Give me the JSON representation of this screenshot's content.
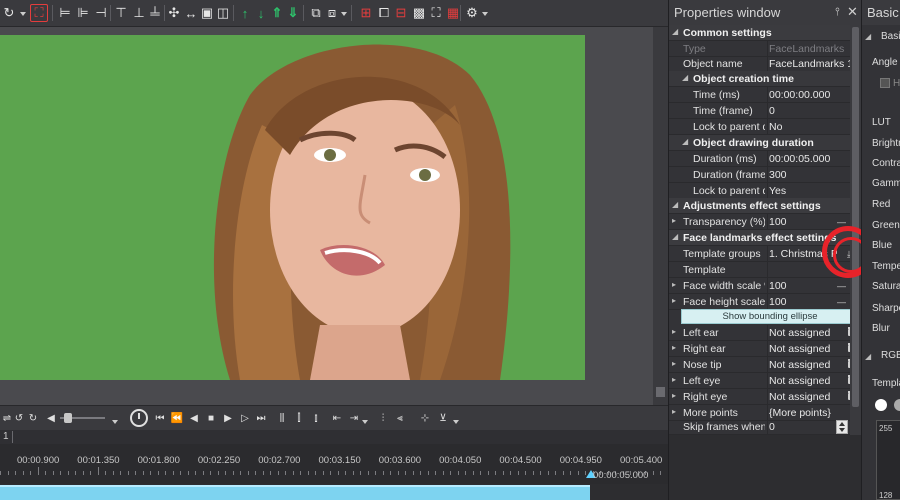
{
  "toolbar": {
    "icons": [
      "redo-icon",
      "select-icon",
      "align-left-icon",
      "align-center-icon",
      "align-right-icon",
      "align-top-icon",
      "align-middle-icon",
      "align-bottom-icon",
      "distribute-h-icon",
      "distribute-v-icon",
      "fit-icon",
      "fill-icon",
      "bring-forward-icon",
      "send-backward-icon",
      "bring-to-front-icon",
      "send-to-back-icon",
      "group-icon",
      "ungroup-icon",
      "grid-icon",
      "snap-icon",
      "safe-area-icon",
      "crop-icon",
      "settings-icon"
    ]
  },
  "transport": {
    "icons": [
      "loop-icon",
      "rewind-icon",
      "undo-icon",
      "volume-icon",
      "clock-icon",
      "go-start-icon",
      "prev-frame-icon",
      "step-back-icon",
      "stop-icon",
      "play-icon",
      "step-forward-icon",
      "next-frame-icon",
      "go-end-icon",
      "split-icon",
      "trim-icon",
      "marker-icon",
      "in-point-icon",
      "out-point-icon",
      "zoom-in-icon",
      "zoom-out-icon"
    ]
  },
  "timeline": {
    "track_number": "1",
    "ticks": [
      "00:00.900",
      "00:01.350",
      "00:01.800",
      "00:02.250",
      "00:02.700",
      "00:03.150",
      "00:03.600",
      "00:04.050",
      "00:04.500",
      "00:04.950",
      "00:05.400"
    ],
    "end_time": "00:00:05.000"
  },
  "properties": {
    "title": "Properties window",
    "pin": "⫯",
    "close": "✕",
    "common": "Common settings",
    "type_key": "Type",
    "type_val": "FaceLandmarks",
    "name_key": "Object name",
    "name_val": "FaceLandmarks 1",
    "creation": "Object creation time",
    "time_ms_key": "Time (ms)",
    "time_ms_val": "00:00:00.000",
    "time_frame_key": "Time (frame)",
    "time_frame_val": "0",
    "lock_parent1_key": "Lock to parent du",
    "lock_parent1_val": "No",
    "drawing": "Object drawing duration",
    "dur_ms_key": "Duration (ms)",
    "dur_ms_val": "00:00:05.000",
    "dur_frames_key": "Duration (frames)",
    "dur_frames_val": "300",
    "lock_parent2_key": "Lock to parent du",
    "lock_parent2_val": "Yes",
    "adjustments": "Adjustments effect settings",
    "transparency_key": "Transparency (%)",
    "transparency_val": "100",
    "facelandmarks": "Face landmarks effect settings",
    "tgroups_key": "Template groups",
    "tgroups_val": "1. Christmas Pac",
    "template_key": "Template",
    "template_val": "",
    "fwidth_key": "Face width scale %",
    "fwidth_val": "100",
    "fheight_key": "Face height scale %",
    "fheight_val": "100",
    "ellipse_btn": "Show bounding ellipse",
    "left_ear_key": "Left ear",
    "left_ear_val": "Not assigned",
    "right_ear_key": "Right ear",
    "right_ear_val": "Not assigned",
    "nose_key": "Nose tip",
    "nose_val": "Not assigned",
    "left_eye_key": "Left eye",
    "left_eye_val": "Not assigned",
    "right_eye_key": "Right eye",
    "right_eye_val": "Not assigned",
    "more_key": "More points",
    "more_val": "{More points}",
    "skip_key": "Skip frames when e",
    "skip_val": "0"
  },
  "basic": {
    "title": "Basic e",
    "section": "Basi",
    "angle": "Angle",
    "check_label": "H",
    "items": [
      "LUT",
      "Brightne",
      "Contras",
      "Gamma",
      "Red",
      "Green",
      "Blue",
      "Temper",
      "Saturati",
      "Sharpe",
      "Blur"
    ],
    "rgb": "RGB",
    "templates": "Templat",
    "graph_top": "255",
    "graph_mid": "128"
  },
  "colors": {
    "accent_highlight": "#e8232a",
    "chroma_green": "#5ca44e",
    "clip_blue": "#7dd3f0",
    "button_mint": "#d7f0f2"
  }
}
